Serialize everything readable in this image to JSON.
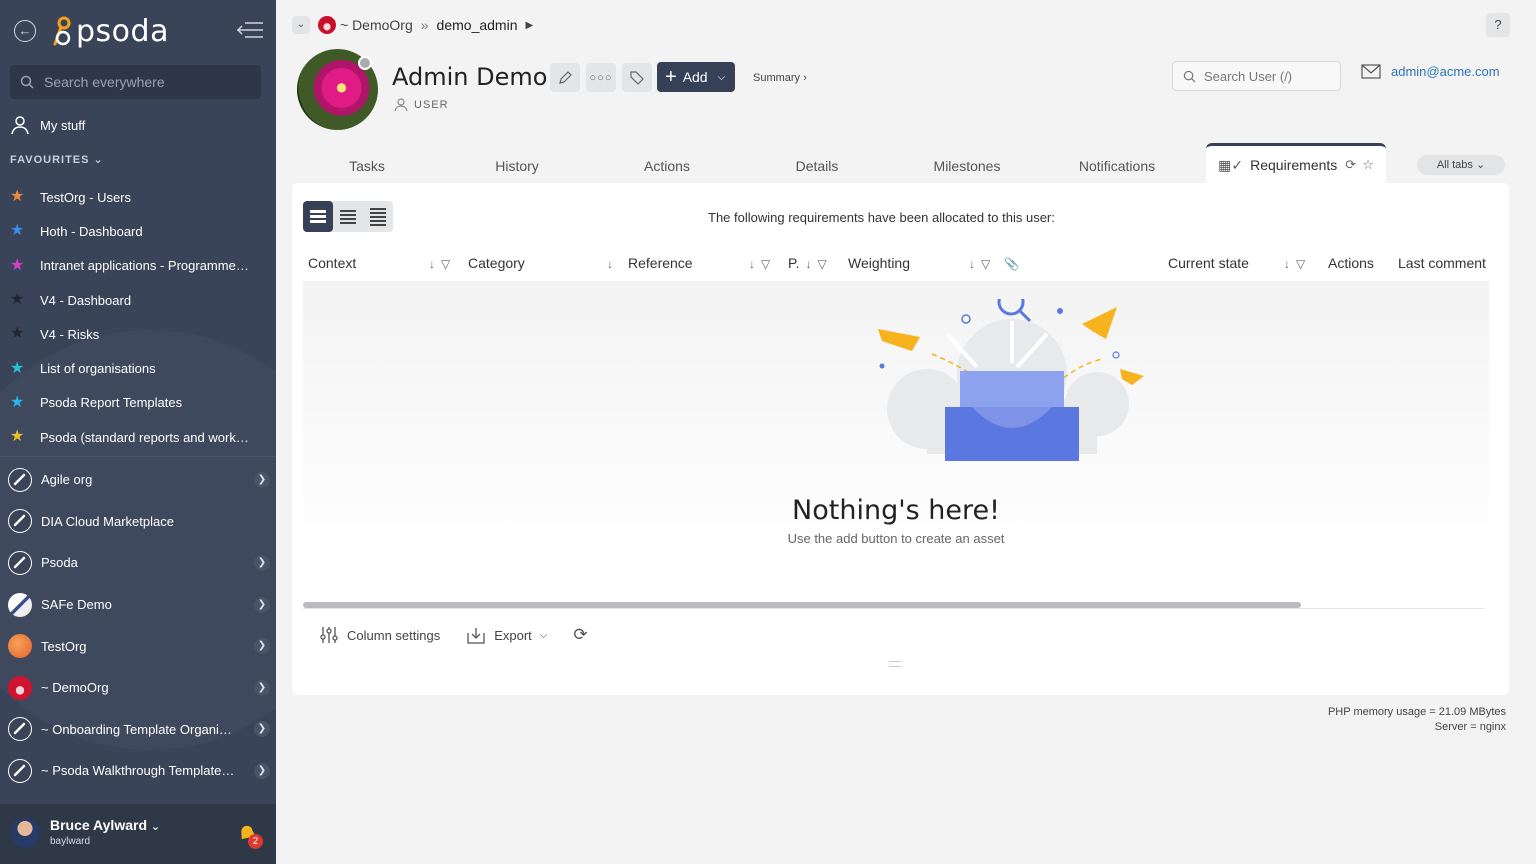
{
  "app": {
    "logo_text": "psoda"
  },
  "sidebar": {
    "search_placeholder": "Search everywhere",
    "my_stuff": "My stuff",
    "favourites_heading": "FAVOURITES",
    "favourites": [
      {
        "label": "TestOrg - Users",
        "color": "#f0883a"
      },
      {
        "label": "Hoth - Dashboard",
        "color": "#3b8be8"
      },
      {
        "label": "Intranet applications - Programme…",
        "color": "#d43fc4"
      },
      {
        "label": "V4 - Dashboard",
        "color": "#2a2f3a"
      },
      {
        "label": "V4 - Risks",
        "color": "#2a2f3a"
      },
      {
        "label": "List of organisations",
        "color": "#29c0d8"
      },
      {
        "label": "Psoda Report Templates",
        "color": "#29b3e8"
      },
      {
        "label": "Psoda (standard reports and work…",
        "color": "#e8c02a"
      }
    ],
    "organisations": [
      {
        "label": "Agile org",
        "icon": "rocket-icon",
        "arrow": true
      },
      {
        "label": "DIA Cloud Marketplace",
        "icon": "rocket-icon",
        "arrow": false
      },
      {
        "label": "Psoda",
        "icon": "rocket-icon",
        "arrow": true
      },
      {
        "label": "SAFe Demo",
        "icon": "safe-logo-icon",
        "arrow": true
      },
      {
        "label": "TestOrg",
        "icon": "orange-circle-icon",
        "arrow": true
      },
      {
        "label": "~ DemoOrg",
        "icon": "flower-icon",
        "arrow": true
      },
      {
        "label": "~ Onboarding Template Organisa…",
        "icon": "rocket-icon",
        "arrow": true
      },
      {
        "label": "~ Psoda Walkthrough Template P…",
        "icon": "rocket-icon",
        "arrow": true
      }
    ],
    "user": {
      "name": "Bruce Aylward",
      "handle": "baylward",
      "notifications": "2"
    }
  },
  "header": {
    "breadcrumb_org": "~ DemoOrg",
    "breadcrumb_sep": "»",
    "breadcrumb_user": "demo_admin",
    "help": "?",
    "title": "Admin Demo",
    "subtitle": "USER",
    "add_label": "Add",
    "summary_link": "Summary ›",
    "search_placeholder": "Search User (/)",
    "email": "admin@acme.com"
  },
  "tabs": [
    {
      "label": "Tasks"
    },
    {
      "label": "History"
    },
    {
      "label": "Actions"
    },
    {
      "label": "Details"
    },
    {
      "label": "Milestones"
    },
    {
      "label": "Notifications"
    },
    {
      "label": "Requirements",
      "active": true
    }
  ],
  "all_tabs": "All tabs ⌄",
  "panel": {
    "note": "The following requirements have been allocated to this user:",
    "columns": [
      "Context",
      "Category",
      "Reference",
      "P.",
      "Weighting",
      "Current state",
      "Actions",
      "Last comment"
    ],
    "empty_title": "Nothing's here!",
    "empty_sub": "Use the add button to create an asset",
    "footer": {
      "column_settings": "Column settings",
      "export": "Export"
    }
  },
  "server_info": {
    "memory": "PHP memory usage = 21.09 MBytes",
    "server": "Server = nginx"
  },
  "colors": {
    "sidebar": "#394459",
    "accent": "#364158",
    "link": "#2e73b8",
    "illustration_blue": "#5b78e0",
    "illustration_yellow": "#f6b31d"
  }
}
